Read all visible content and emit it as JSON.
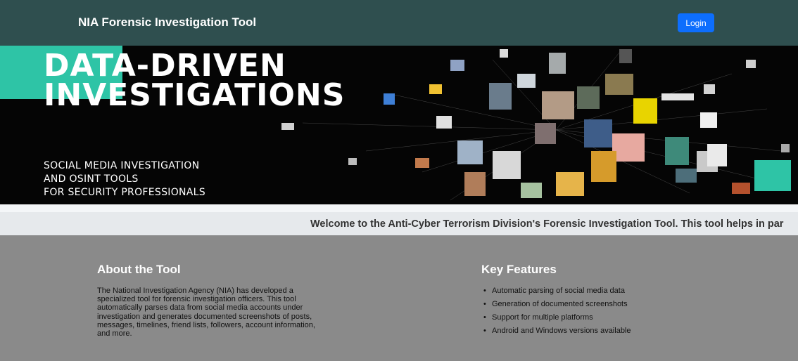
{
  "navbar": {
    "brand": "NIA Forensic Investigation Tool",
    "login_label": "Login",
    "background": "#2f4f4f",
    "button_color": "#0d6efd"
  },
  "banner": {
    "headline_line1": "DATA-DRIVEN",
    "headline_line2": "INVESTIGATIONS",
    "sub_line1": "SOCIAL MEDIA INVESTIGATION",
    "sub_line2": "AND OSINT TOOLS",
    "sub_line3": "FOR SECURITY PROFESSIONALS",
    "accent": "#2ec4a6"
  },
  "marquee": {
    "text": "Welcome to the Anti-Cyber Terrorism Division's Forensic Investigation Tool. This tool helps in par"
  },
  "about": {
    "title": "About the Tool",
    "body": "The National Investigation Agency (NIA) has developed a specialized tool for forensic investigation officers. This tool automatically parses data from social media accounts under investigation and generates documented screenshots of posts, messages, timelines, friend lists, followers, account information, and more."
  },
  "features": {
    "title": "Key Features",
    "items": [
      "Automatic parsing of social media data",
      "Generation of documented screenshots",
      "Support for multiple platforms",
      "Android and Windows versions available"
    ]
  }
}
